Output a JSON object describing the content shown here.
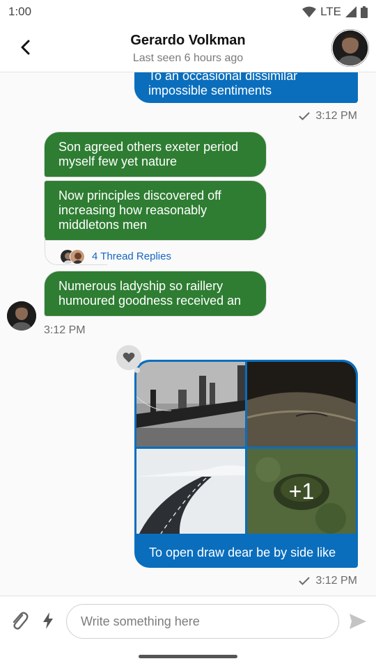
{
  "status_bar": {
    "time": "1:00",
    "network": "LTE"
  },
  "header": {
    "title": "Gerardo Volkman",
    "subtitle": "Last seen 6 hours ago"
  },
  "messages": [
    {
      "direction": "out",
      "text": "To an occasional dissimilar impossible sentiments",
      "time": "3:12 PM",
      "read_icon": "check-icon"
    },
    {
      "direction": "in",
      "text": "Son agreed others exeter period myself few yet nature"
    },
    {
      "direction": "in",
      "text": "Now principles discovered off increasing how reasonably middletons men",
      "thread_replies": "4 Thread Replies"
    },
    {
      "direction": "in",
      "text": "Numerous ladyship so raillery humoured goodness received an",
      "time": "3:12 PM"
    },
    {
      "direction": "out",
      "attachment_count_more": "+1",
      "text": "To open draw dear be by side like",
      "time": "3:12 PM",
      "reaction": "heart-icon"
    }
  ],
  "composer": {
    "placeholder": "Write something here"
  },
  "colors": {
    "outgoing_bubble": "#0a6ebd",
    "incoming_bubble": "#2e7d32",
    "thread_link": "#1565c0"
  }
}
